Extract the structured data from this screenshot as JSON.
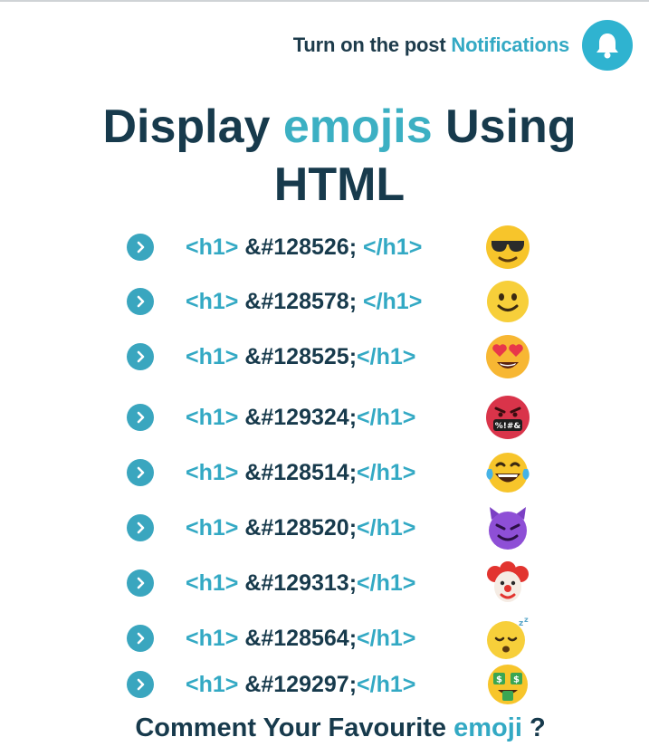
{
  "header": {
    "notif_prefix": "Turn on the post",
    "notif_accent": "Notifications",
    "bell_icon": "bell-icon"
  },
  "title": {
    "part1": "Display",
    "accent": "emojis",
    "part2": "Using",
    "line2": "HTML"
  },
  "rows": [
    {
      "open": "<h1>",
      "code": " &#128526; ",
      "close": "</h1>",
      "emoji": "sunglasses-face"
    },
    {
      "open": "<h1>",
      "code": " &#128578; ",
      "close": "</h1>",
      "emoji": "slightly-smiling-face"
    },
    {
      "open": "<h1>",
      "code": " &#128525;",
      "close": "</h1>",
      "emoji": "heart-eyes-face"
    },
    {
      "open": "<h1>",
      "code": " &#129324;",
      "close": "</h1>",
      "emoji": "cursing-face"
    },
    {
      "open": "<h1>",
      "code": " &#128514;",
      "close": "</h1>",
      "emoji": "tears-of-joy-face"
    },
    {
      "open": "<h1>",
      "code": " &#128520;",
      "close": "</h1>",
      "emoji": "smiling-devil-face"
    },
    {
      "open": "<h1>",
      "code": " &#129313;",
      "close": "</h1>",
      "emoji": "clown-face"
    },
    {
      "open": "<h1>",
      "code": " &#128564;",
      "close": "</h1>",
      "emoji": "sleeping-face"
    },
    {
      "open": "<h1>",
      "code": " &#129297;",
      "close": "</h1>",
      "emoji": "money-mouth-face"
    }
  ],
  "footer": {
    "prefix": "Comment Your Favourite",
    "accent": "emoji",
    "suffix": " ?"
  },
  "colors": {
    "navy": "#173a4c",
    "teal": "#33a9c4",
    "bell": "#2fb3d0",
    "emoji_yellow": "#f7c52b"
  }
}
